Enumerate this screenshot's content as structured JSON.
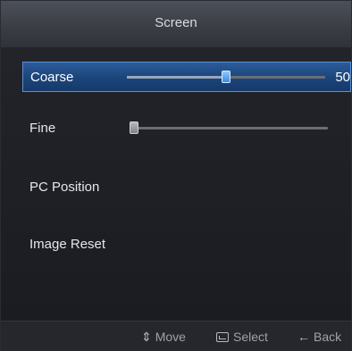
{
  "title": "Screen",
  "items": [
    {
      "label": "Coarse",
      "value": "50",
      "level": 0.5
    },
    {
      "label": "Fine",
      "level": 0.0
    },
    {
      "label": "PC Position"
    },
    {
      "label": "Image Reset"
    }
  ],
  "footer": {
    "move": "Move",
    "select": "Select",
    "back": "Back"
  },
  "colors": {
    "selection": "#1d467c",
    "selection_border": "#5c8fd2",
    "thumb_active": "#3a8de4"
  },
  "icons": {
    "move": "up-down-arrows-icon",
    "select": "enter-icon",
    "back": "left-arrow-icon"
  }
}
